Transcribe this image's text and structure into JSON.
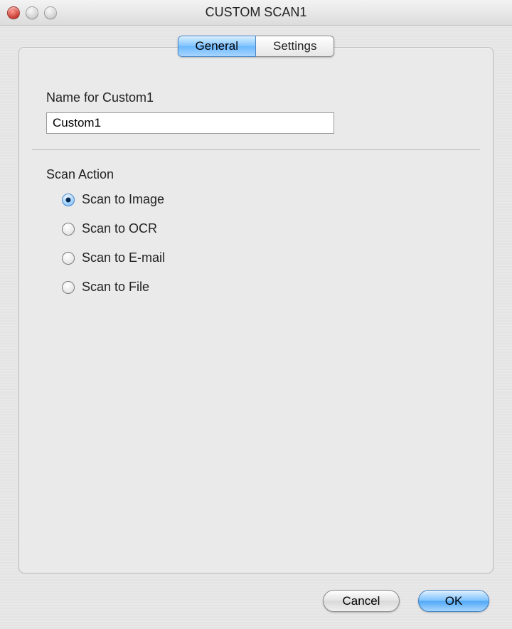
{
  "window": {
    "title": "CUSTOM SCAN1"
  },
  "tabs": {
    "general": "General",
    "settings": "Settings",
    "active": "general"
  },
  "fields": {
    "name_label": "Name for Custom1",
    "name_value": "Custom1"
  },
  "scan_action": {
    "label": "Scan Action",
    "selected": 0,
    "options": [
      "Scan to Image",
      "Scan to OCR",
      "Scan to E-mail",
      "Scan to File"
    ]
  },
  "buttons": {
    "cancel": "Cancel",
    "ok": "OK"
  }
}
